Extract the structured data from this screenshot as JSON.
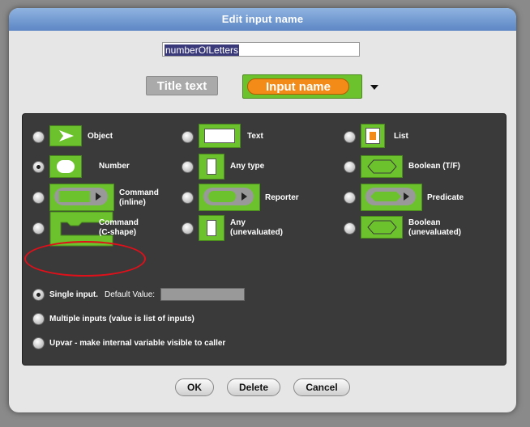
{
  "dialog": {
    "title": "Edit input name"
  },
  "name_field": {
    "value": "numberOfLetters"
  },
  "preview": {
    "title_text": "Title text",
    "input_name": "Input name"
  },
  "types": [
    {
      "id": "object",
      "label": "Object"
    },
    {
      "id": "text",
      "label": "Text"
    },
    {
      "id": "list",
      "label": "List"
    },
    {
      "id": "number",
      "label": "Number",
      "selected": true
    },
    {
      "id": "any-type",
      "label": "Any type"
    },
    {
      "id": "boolean",
      "label": "Boolean (T/F)"
    },
    {
      "id": "command-inline",
      "label": "Command\n(inline)"
    },
    {
      "id": "reporter",
      "label": "Reporter"
    },
    {
      "id": "predicate",
      "label": "Predicate"
    },
    {
      "id": "command-c",
      "label": "Command\n(C-shape)"
    },
    {
      "id": "any-unevaluated",
      "label": "Any\n(unevaluated)"
    },
    {
      "id": "boolean-unevaluated",
      "label": "Boolean\n(unevaluated)"
    }
  ],
  "modes": {
    "single": "Single input.",
    "default_label": "Default Value:",
    "multiple": "Multiple inputs (value is list of inputs)",
    "upvar": "Upvar - make internal variable visible to caller"
  },
  "buttons": {
    "ok": "OK",
    "delete": "Delete",
    "cancel": "Cancel"
  },
  "colors": {
    "block_green": "#6cc22c",
    "panel": "#3a3a3a",
    "highlight": "#e0101a",
    "input_orange": "#f28b18"
  }
}
